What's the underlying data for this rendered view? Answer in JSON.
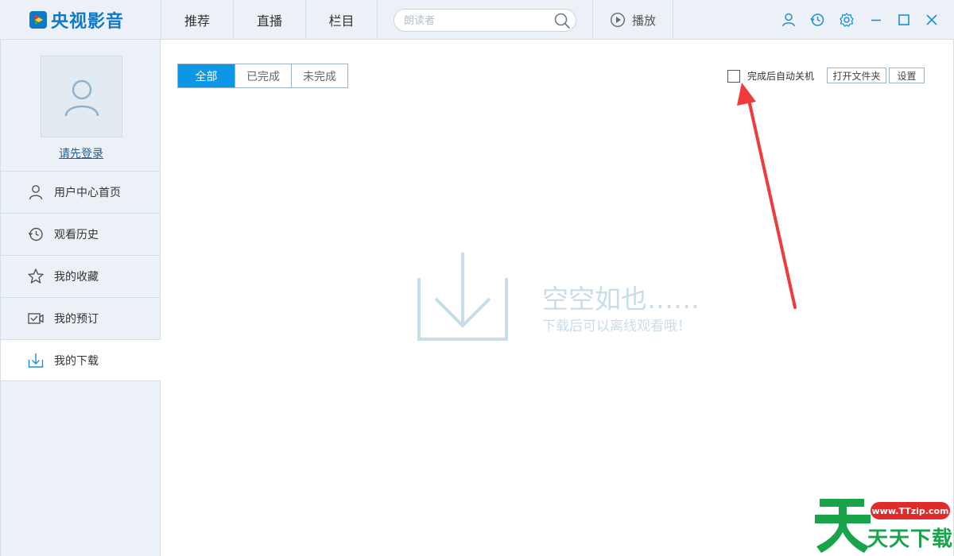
{
  "app": {
    "logo_text": "央视影音"
  },
  "nav": {
    "tabs": [
      {
        "label": "推荐"
      },
      {
        "label": "直播"
      },
      {
        "label": "栏目"
      }
    ],
    "search_placeholder": "朗读者",
    "play_label": "播放"
  },
  "sidebar": {
    "login_label": "请先登录",
    "items": [
      {
        "label": "用户中心首页",
        "icon": "user-icon"
      },
      {
        "label": "观看历史",
        "icon": "history-icon"
      },
      {
        "label": "我的收藏",
        "icon": "star-icon"
      },
      {
        "label": "我的预订",
        "icon": "reservation-icon"
      },
      {
        "label": "我的下载",
        "icon": "download-icon",
        "active": true
      }
    ]
  },
  "main": {
    "filter_tabs": [
      {
        "label": "全部",
        "active": true
      },
      {
        "label": "已完成"
      },
      {
        "label": "未完成"
      }
    ],
    "auto_shutdown_label": "完成后自动关机",
    "auto_shutdown_checked": false,
    "open_folder_label": "打开文件夹",
    "settings_label": "设置",
    "empty_title": "空空如也……",
    "empty_subtitle": "下载后可以离线观看哦！"
  },
  "watermark": {
    "badge": "www.TTzip.com",
    "text": "天天下载"
  },
  "colors": {
    "accent": "#0e96e6",
    "brand": "#0e78c9",
    "arrow": "#ef3b3b"
  }
}
